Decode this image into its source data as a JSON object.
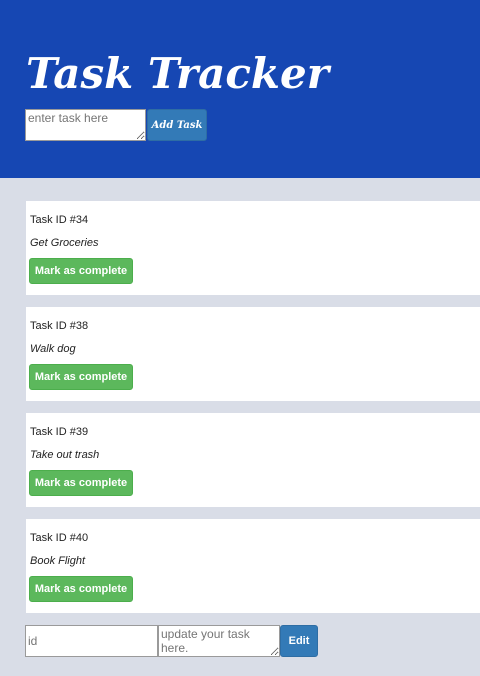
{
  "header": {
    "title": "Task Tracker",
    "new_task_placeholder": "enter task here",
    "add_button_label": "Add Task"
  },
  "tasks": [
    {
      "id_label": "Task ID #34",
      "text": "Get Groceries",
      "complete_label": "Mark as complete"
    },
    {
      "id_label": "Task ID #38",
      "text": "Walk dog",
      "complete_label": "Mark as complete"
    },
    {
      "id_label": "Task ID #39",
      "text": "Take out trash",
      "complete_label": "Mark as complete"
    },
    {
      "id_label": "Task ID #40",
      "text": "Book Flight",
      "complete_label": "Mark as complete"
    }
  ],
  "edit_form": {
    "id_placeholder": "id",
    "update_placeholder": "update your task here.",
    "edit_button_label": "Edit"
  },
  "colors": {
    "header_bg": "#1647b3",
    "page_bg": "#d9dde7",
    "primary_button": "#337ab7",
    "success_button": "#5cb85c"
  }
}
